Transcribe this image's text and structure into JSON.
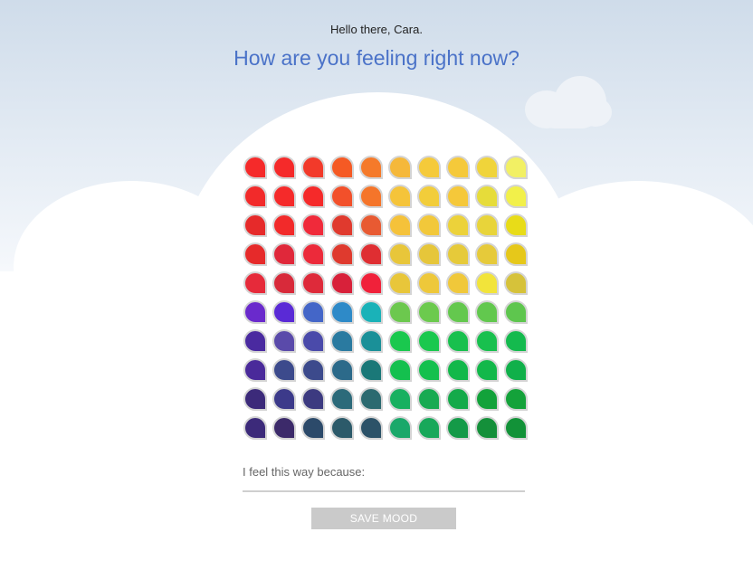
{
  "header": {
    "greeting": "Hello there, Cara.",
    "question": "How are you feeling right now?"
  },
  "mood_grid": {
    "rows": [
      [
        "#f52a2a",
        "#f52a2a",
        "#f23a2a",
        "#f55a24",
        "#f57a2a",
        "#f5b83a",
        "#f5ca3a",
        "#f5c93a",
        "#f0d43a",
        "#f2f064"
      ],
      [
        "#f22a2a",
        "#f52a2a",
        "#f52a2a",
        "#f2502a",
        "#f5752a",
        "#f5c43a",
        "#f2cd3a",
        "#f5c83a",
        "#e6dc3a",
        "#f2f04a"
      ],
      [
        "#e62a2a",
        "#f22a2a",
        "#f02a3a",
        "#e03a2e",
        "#e85a32",
        "#f5c23a",
        "#f2c83a",
        "#ecd23a",
        "#e8d43a",
        "#e8dc18"
      ],
      [
        "#e62a2a",
        "#e0283a",
        "#ec2a3a",
        "#df3a2e",
        "#df2e32",
        "#e8c63a",
        "#e6c63a",
        "#e6ca3a",
        "#e6ca3a",
        "#e6c81a"
      ],
      [
        "#e62a3a",
        "#d82a3a",
        "#de2a3a",
        "#d8213a",
        "#f0213a",
        "#e8c63a",
        "#eec83a",
        "#f0c83a",
        "#f2e43a",
        "#d6c23a"
      ],
      [
        "#6a2acc",
        "#5a2ad6",
        "#4466c8",
        "#2e8ac8",
        "#1ab2b8",
        "#6cc84e",
        "#6cca4e",
        "#64c84e",
        "#62c84e",
        "#5ec64e"
      ],
      [
        "#4a2aa0",
        "#5a4aaa",
        "#4a4aaa",
        "#2a7aa0",
        "#1a9098",
        "#1ac84e",
        "#1ac84e",
        "#18c04e",
        "#18c04e",
        "#14ba4e"
      ],
      [
        "#4a2a9a",
        "#3c4a8c",
        "#3c4a8c",
        "#2c6a8a",
        "#1a7878",
        "#14c04e",
        "#14c04e",
        "#12b84a",
        "#12b84a",
        "#10b04a"
      ],
      [
        "#3c2a7a",
        "#3c3a8a",
        "#3c3a80",
        "#2c6a7a",
        "#2c6a70",
        "#18b060",
        "#18aa52",
        "#14aa4a",
        "#12a23a",
        "#14a23a"
      ],
      [
        "#3c2a7a",
        "#3c2a6a",
        "#2c4a6a",
        "#2c5a6a",
        "#2c5268",
        "#1aa86a",
        "#18a85a",
        "#149a48",
        "#14903a",
        "#129238"
      ]
    ]
  },
  "reason": {
    "label": "I feel this way because:",
    "value": ""
  },
  "save_button": {
    "label": "SAVE MOOD"
  }
}
